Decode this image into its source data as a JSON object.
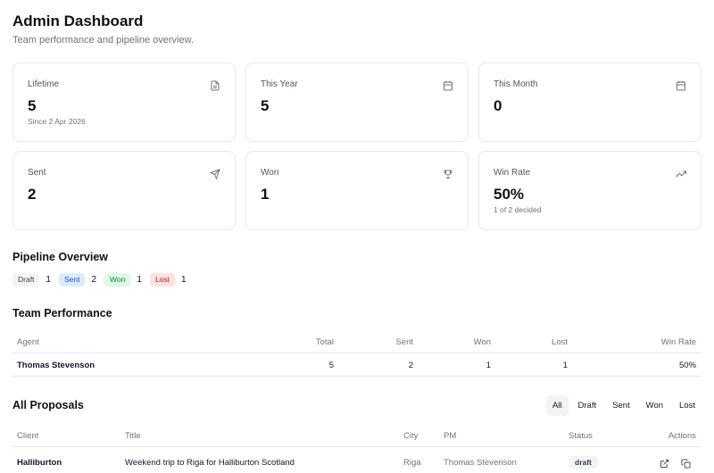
{
  "header": {
    "title": "Admin Dashboard",
    "subtitle": "Team performance and pipeline overview."
  },
  "stats": {
    "lifetime": {
      "label": "Lifetime",
      "value": "5",
      "sub": "Since 2 Apr 2026",
      "icon": "document-icon"
    },
    "this_year": {
      "label": "This Year",
      "value": "5",
      "icon": "calendar-icon"
    },
    "this_month": {
      "label": "This Month",
      "value": "0",
      "icon": "calendar-icon"
    },
    "sent": {
      "label": "Sent",
      "value": "2",
      "icon": "send-icon"
    },
    "won": {
      "label": "Won",
      "value": "1",
      "icon": "trophy-icon"
    },
    "win_rate": {
      "label": "Win Rate",
      "value": "50%",
      "sub": "1 of 2 decided",
      "icon": "trending-up-icon"
    }
  },
  "pipeline": {
    "title": "Pipeline Overview",
    "items": [
      {
        "label": "Draft",
        "count": "1"
      },
      {
        "label": "Sent",
        "count": "2"
      },
      {
        "label": "Won",
        "count": "1"
      },
      {
        "label": "Lost",
        "count": "1"
      }
    ]
  },
  "team": {
    "title": "Team Performance",
    "columns": [
      "Agent",
      "Total",
      "Sent",
      "Won",
      "Lost",
      "Win Rate"
    ],
    "rows": [
      {
        "agent": "Thomas Stevenson",
        "total": "5",
        "sent": "2",
        "won": "1",
        "lost": "1",
        "win_rate": "50%"
      }
    ]
  },
  "proposals": {
    "title": "All Proposals",
    "filters": [
      "All",
      "Draft",
      "Sent",
      "Won",
      "Lost"
    ],
    "active_filter": "All",
    "columns": [
      "Client",
      "Title",
      "City",
      "PM",
      "Status",
      "Actions"
    ],
    "rows": [
      {
        "client": "Halliburton",
        "title": "Weekend trip to Riga for Halliburton Scotland",
        "city": "Riga",
        "pm": "Thomas Stevenson",
        "status": "draft"
      }
    ]
  },
  "colors": {
    "draft_bg": "#f3f4f6",
    "sent_bg": "#dbeafe",
    "won_bg": "#dcfce7",
    "lost_bg": "#fee2e2"
  }
}
